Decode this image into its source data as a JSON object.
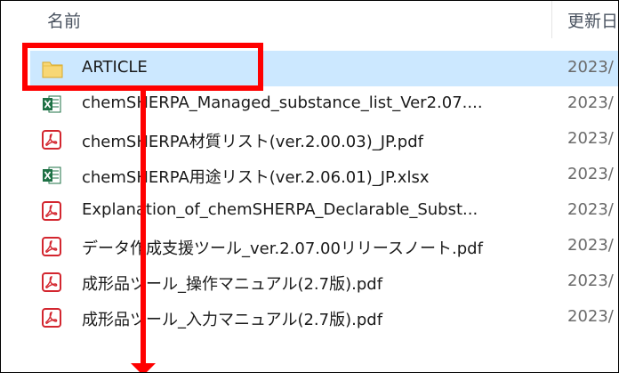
{
  "header": {
    "name_label": "名前",
    "date_label": "更新日"
  },
  "files": [
    {
      "name": "ARTICLE",
      "date": "2023/",
      "icon": "folder-icon",
      "selected": true
    },
    {
      "name": "chemSHERPA_Managed_substance_list_Ver2.07....",
      "date": "2023/",
      "icon": "excel-icon"
    },
    {
      "name": "chemSHERPA材質リスト(ver.2.00.03)_JP.pdf",
      "date": "2023/",
      "icon": "pdf-icon"
    },
    {
      "name": "chemSHERPA用途リスト(ver.2.06.01)_JP.xlsx",
      "date": "2023/",
      "icon": "excel-icon"
    },
    {
      "name": "Explanation_of_chemSHERPA_Declarable_Subst...",
      "date": "2023/",
      "icon": "pdf-icon"
    },
    {
      "name": "データ作成支援ツール_ver.2.07.00リリースノート.pdf",
      "date": "2023/",
      "icon": "pdf-icon"
    },
    {
      "name": "成形品ツール_操作マニュアル(2.7版).pdf",
      "date": "2023/",
      "icon": "pdf-icon"
    },
    {
      "name": "成形品ツール_入力マニュアル(2.7版).pdf",
      "date": "2023/",
      "icon": "pdf-icon"
    }
  ],
  "colors": {
    "selection": "#cce8ff",
    "annotation": "#ff0000",
    "pdf_red": "#d3262f",
    "excel_green": "#1e7145",
    "folder_yellow": "#f8d775"
  }
}
